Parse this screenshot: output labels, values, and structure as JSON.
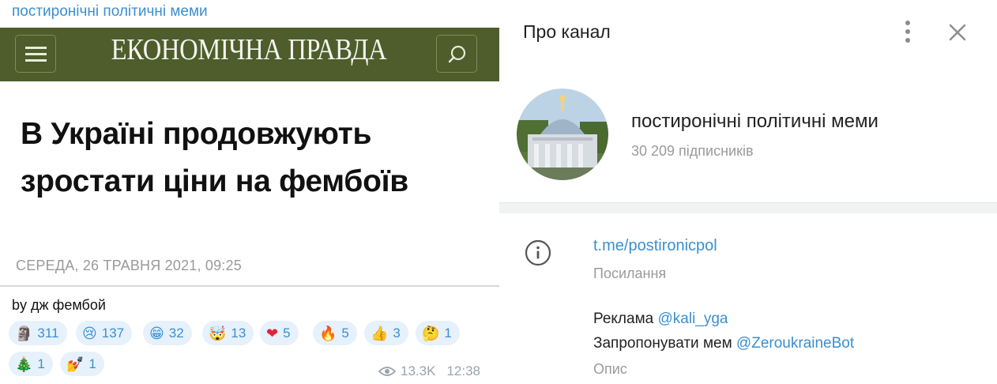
{
  "post": {
    "channel_name": "постиронічні політичні меми",
    "site_logo": "ЕКОНОМІЧНА ПРАВДА",
    "headline": "В Україні продовжують зростати ціни на фембоїв",
    "date": "СЕРЕДА, 26 ТРАВНЯ 2021, 09:25",
    "author_line": "by дж фембой",
    "reactions": [
      {
        "emoji": "🗿",
        "icon": "moai-icon",
        "count": "311"
      },
      {
        "emoji": "😢",
        "icon": "crying-face-icon",
        "count": "137"
      },
      {
        "emoji": "😁",
        "icon": "grinning-face-icon",
        "count": "32"
      },
      {
        "emoji": "🤯",
        "icon": "exploding-head-icon",
        "count": "13"
      },
      {
        "emoji": "❤",
        "icon": "heart-icon",
        "count": "5"
      },
      {
        "emoji": "🔥",
        "icon": "fire-icon",
        "count": "5"
      },
      {
        "emoji": "👍",
        "icon": "thumbs-up-icon",
        "count": "3"
      },
      {
        "emoji": "🤔",
        "icon": "thinking-face-icon",
        "count": "1"
      },
      {
        "emoji": "🎄",
        "icon": "christmas-tree-icon",
        "count": "1"
      },
      {
        "emoji": "💅",
        "icon": "nail-polish-icon",
        "count": "1"
      }
    ],
    "views": "13.3K",
    "time": "12:38"
  },
  "channel_info": {
    "title": "Про канал",
    "name": "постиронічні політичні меми",
    "subscribers": "30 209 підписників",
    "link": "t.me/postironicpol",
    "link_caption": "Посилання",
    "ads_label": "Реклама",
    "ads_mention": "@kali_yga",
    "suggest_label": "Запропонувати мем",
    "suggest_mention": "@ZeroukraineBot",
    "description_caption": "Опис"
  },
  "colors": {
    "accent": "#3a8fd1",
    "header_bg": "#4e5d2b",
    "reaction_bg": "#e6f1fb"
  }
}
